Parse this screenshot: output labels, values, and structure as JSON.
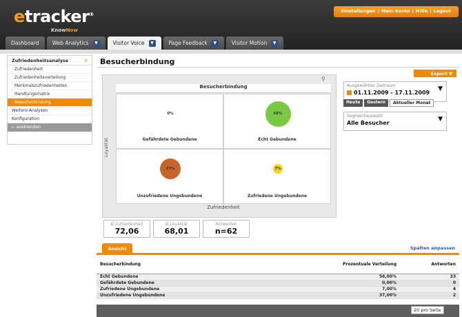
{
  "app": {
    "logo": "etracker",
    "logo_sub_know": "Know",
    "logo_sub_now": "Now",
    "reg": "®"
  },
  "topmenu": [
    "Einstellungen",
    "Mein Konto",
    "Hilfe",
    "Logout"
  ],
  "tabs": [
    {
      "label": "Dashboard",
      "active": false,
      "dropdown": false
    },
    {
      "label": "Web Analytics",
      "active": false,
      "dropdown": true
    },
    {
      "label": "Visitor Voice",
      "active": true,
      "dropdown": true
    },
    {
      "label": "Page Feedback",
      "active": false,
      "dropdown": true
    },
    {
      "label": "Visitor Motion",
      "active": false,
      "dropdown": true
    }
  ],
  "sidebar": {
    "section": "Zufriedenheitsanalyse",
    "items": [
      "Zufriedenheit",
      "Zufriedenheitsverteilung",
      "Merkmalszufriedenheiten",
      "Handlungsmatrix",
      "Besucherbindung"
    ],
    "active_index": 4,
    "top_items": [
      "Weitere Analysen",
      "Konfiguration"
    ],
    "hide_label": "← ausblenden"
  },
  "page": {
    "title": "Besucherbindung",
    "export_label": "Export"
  },
  "matrix": {
    "title": "Besucherbindung",
    "x_label": "Zufriedenheit",
    "y_label": "Loyalität",
    "quadrants": [
      {
        "name": "Gefährdete Gebundene",
        "pct": "0%",
        "value": 0,
        "color": "#ffffff"
      },
      {
        "name": "Echt Gebundene",
        "pct": "56%",
        "value": 56,
        "color": "#7ac943"
      },
      {
        "name": "Unzufriedene Ungebundene",
        "pct": "37%",
        "value": 37,
        "color": "#c8642a"
      },
      {
        "name": "Zufriedene Ungebundene",
        "pct": "7%",
        "value": 7,
        "color": "#f5d31c"
      }
    ]
  },
  "period": {
    "label": "Ausgewählter Zeitraum",
    "value": "01.11.2009 - 17.11.2009",
    "buttons": [
      "Heute",
      "Gestern",
      "Aktueller Monat"
    ]
  },
  "segment": {
    "label": "Segmentauswahl",
    "value": "Alle Besucher"
  },
  "stats": [
    {
      "label": "Ø Zufriedenheit",
      "value": "72,06"
    },
    {
      "label": "Ø Loyalität",
      "value": "68,01"
    },
    {
      "label": "Antworten",
      "value": "n=62"
    }
  ],
  "view_tab": "Ansicht",
  "columns_link": "Spalten anpassen",
  "table": {
    "headers": [
      "Besucherbindung",
      "Prozentuale Verteilung",
      "Antworten"
    ],
    "rows": [
      [
        "Echt Gebundene",
        "56,00%",
        "33"
      ],
      [
        "Gefährdete Gebundene",
        "0,00%",
        "0"
      ],
      [
        "Zufriedene Ungebundene",
        "7,00%",
        "4"
      ],
      [
        "Unzufriedene Ungebundene",
        "37,00%",
        "2"
      ]
    ]
  },
  "pager": {
    "per_page": "20 pro Seite"
  }
}
